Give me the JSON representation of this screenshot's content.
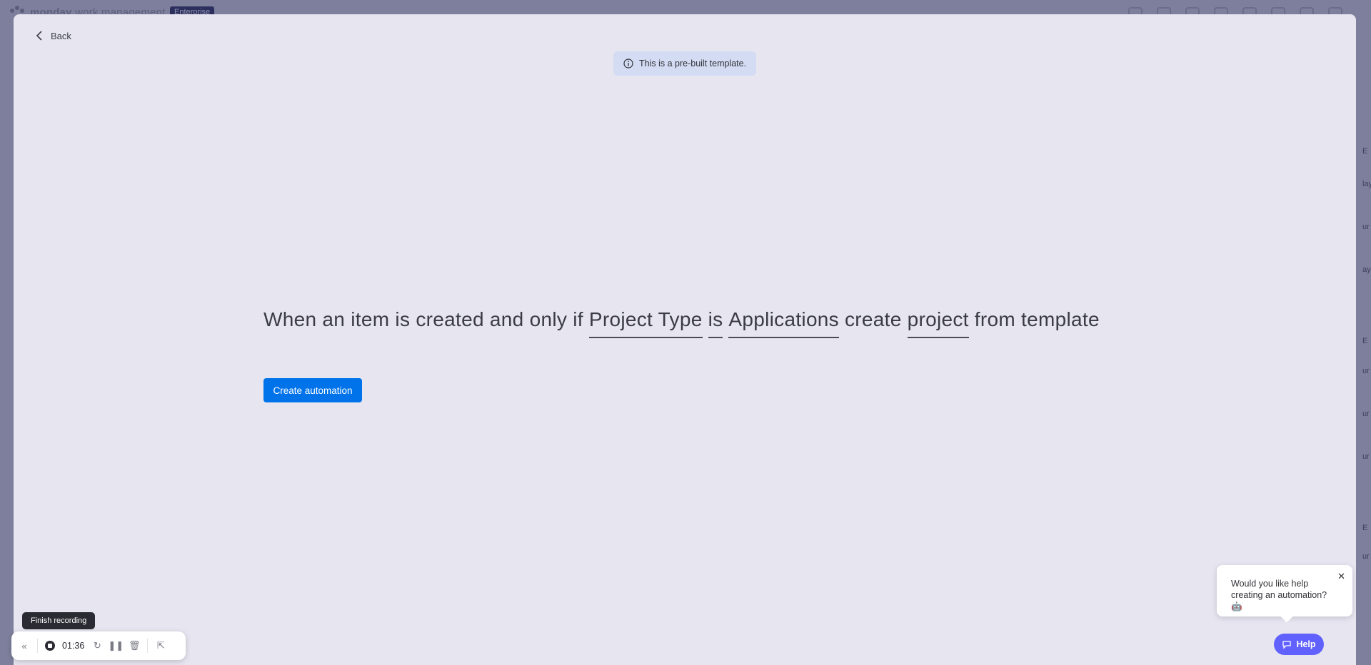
{
  "background": {
    "brand": "monday",
    "brand_suffix": "work management",
    "badge": "Enterprise",
    "right_letters": [
      "E",
      "lay",
      "ur",
      "ay",
      "E",
      "ur",
      "ur",
      "ur",
      "E",
      "ur"
    ]
  },
  "modal": {
    "back_label": "Back",
    "notice": {
      "icon": "info-icon",
      "text": "This is a pre-built template."
    },
    "sentence": {
      "parts": [
        {
          "text": "When an item is created and only if",
          "field": false
        },
        {
          "text": "Project Type",
          "field": true
        },
        {
          "text": "is",
          "field": true
        },
        {
          "text": "Applications",
          "field": true
        },
        {
          "text": "create",
          "field": false
        },
        {
          "text": "project",
          "field": true
        },
        {
          "text": "from template",
          "field": false
        }
      ]
    },
    "create_button": "Create automation"
  },
  "help": {
    "popup_text": "Would you like help creating an automation? 🤖",
    "close_icon": "close-icon",
    "button_label": "Help",
    "button_icon": "chat-icon"
  },
  "recorder": {
    "tooltip": "Finish recording",
    "time": "01:36",
    "icons": [
      "collapse-icon",
      "stop-record-icon",
      "restart-icon",
      "pause-icon",
      "delete-icon",
      "pointer-icon"
    ]
  },
  "colors": {
    "primary": "#0073ea",
    "help": "#6161ff",
    "notice_bg": "#d3dcf3",
    "modal_bg": "#e6e5f0"
  }
}
